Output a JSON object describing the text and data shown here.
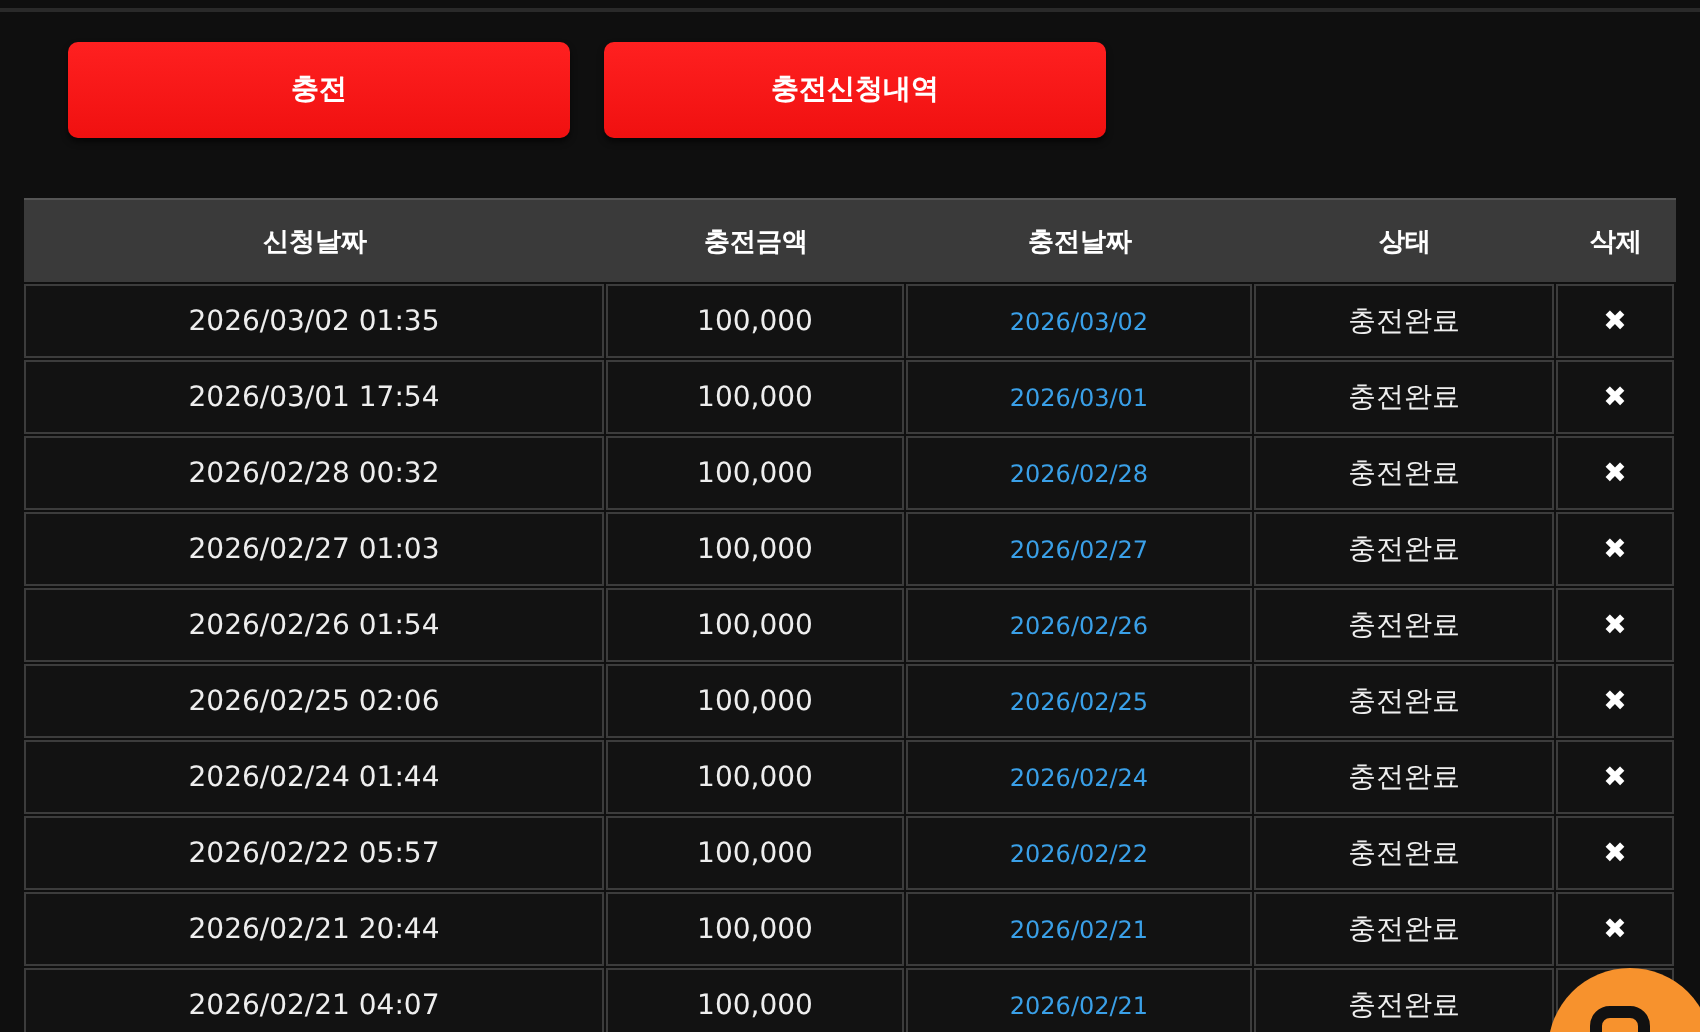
{
  "buttons": [
    {
      "label": "충전"
    },
    {
      "label": "충전신청내역"
    }
  ],
  "table": {
    "columns": [
      "신청날짜",
      "충전금액",
      "충전날짜",
      "상태",
      "삭제"
    ],
    "rows": [
      {
        "requested": "2026/03/02 01:35",
        "amount": "100,000",
        "charged": "2026/03/02",
        "status": "충전완료",
        "delete": "✖"
      },
      {
        "requested": "2026/03/01 17:54",
        "amount": "100,000",
        "charged": "2026/03/01",
        "status": "충전완료",
        "delete": "✖"
      },
      {
        "requested": "2026/02/28 00:32",
        "amount": "100,000",
        "charged": "2026/02/28",
        "status": "충전완료",
        "delete": "✖"
      },
      {
        "requested": "2026/02/27 01:03",
        "amount": "100,000",
        "charged": "2026/02/27",
        "status": "충전완료",
        "delete": "✖"
      },
      {
        "requested": "2026/02/26 01:54",
        "amount": "100,000",
        "charged": "2026/02/26",
        "status": "충전완료",
        "delete": "✖"
      },
      {
        "requested": "2026/02/25 02:06",
        "amount": "100,000",
        "charged": "2026/02/25",
        "status": "충전완료",
        "delete": "✖"
      },
      {
        "requested": "2026/02/24 01:44",
        "amount": "100,000",
        "charged": "2026/02/24",
        "status": "충전완료",
        "delete": "✖"
      },
      {
        "requested": "2026/02/22 05:57",
        "amount": "100,000",
        "charged": "2026/02/22",
        "status": "충전완료",
        "delete": "✖"
      },
      {
        "requested": "2026/02/21 20:44",
        "amount": "100,000",
        "charged": "2026/02/21",
        "status": "충전완료",
        "delete": "✖"
      },
      {
        "requested": "2026/02/21 04:07",
        "amount": "100,000",
        "charged": "2026/02/21",
        "status": "충전완료"
      }
    ]
  }
}
